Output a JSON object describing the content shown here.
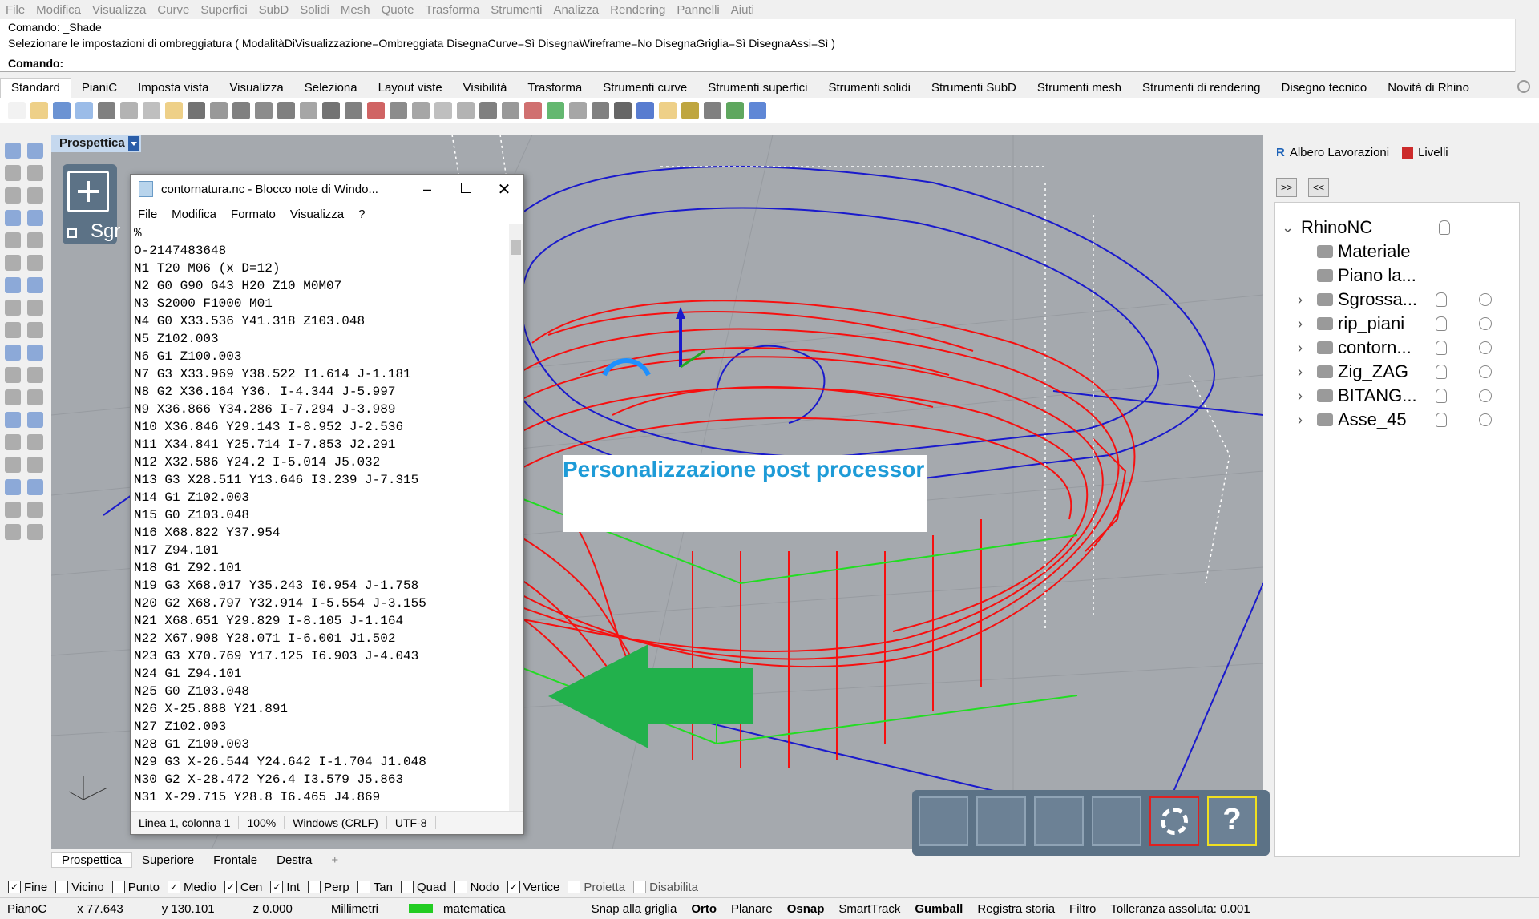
{
  "menubar": [
    "File",
    "Modifica",
    "Visualizza",
    "Curve",
    "Superfici",
    "SubD",
    "Solidi",
    "Mesh",
    "Quote",
    "Trasforma",
    "Strumenti",
    "Analizza",
    "Rendering",
    "Pannelli",
    "Aiuti"
  ],
  "command": {
    "line1": "Comando: _Shade",
    "line2": "Selezionare le impostazioni di ombreggiatura ( ModalitàDiVisualizzazione=Ombreggiata  DisegnaCurve=Sì  DisegnaWireframe=No  DisegnaGriglia=Sì  DisegnaAssi=Sì )",
    "prompt": "Comando:"
  },
  "tabs": [
    "Standard",
    "PianiC",
    "Imposta vista",
    "Visualizza",
    "Seleziona",
    "Layout viste",
    "Visibilità",
    "Trasforma",
    "Strumenti curve",
    "Strumenti superfici",
    "Strumenti solidi",
    "Strumenti SubD",
    "Strumenti mesh",
    "Strumenti di rendering",
    "Disegno tecnico",
    "Novità di Rhino"
  ],
  "viewport": {
    "title": "Prospettica",
    "overlay_text": "Personalizzazione post processor",
    "panel_label": "Sgr"
  },
  "notepad": {
    "title": "contornatura.nc - Blocco note di Windo...",
    "menu": [
      "File",
      "Modifica",
      "Formato",
      "Visualizza",
      "?"
    ],
    "lines": [
      "%",
      "O-2147483648",
      "N1 T20 M06 (x D=12)",
      "N2 G0 G90 G43 H20 Z10 M0M07",
      "N3 S2000 F1000 M01",
      "N4 G0 X33.536 Y41.318 Z103.048",
      "N5 Z102.003",
      "N6 G1 Z100.003",
      "N7 G3 X33.969 Y38.522 I1.614 J-1.181",
      "N8 G2 X36.164 Y36. I-4.344 J-5.997",
      "N9 X36.866 Y34.286 I-7.294 J-3.989",
      "N10 X36.846 Y29.143 I-8.952 J-2.536",
      "N11 X34.841 Y25.714 I-7.853 J2.291",
      "N12 X32.586 Y24.2 I-5.014 J5.032",
      "N13 G3 X28.511 Y13.646 I3.239 J-7.315",
      "N14 G1 Z102.003",
      "N15 G0 Z103.048",
      "N16 X68.822 Y37.954",
      "N17 Z94.101",
      "N18 G1 Z92.101",
      "N19 G3 X68.017 Y35.243 I0.954 J-1.758",
      "N20 G2 X68.797 Y32.914 I-5.554 J-3.155",
      "N21 X68.651 Y29.829 I-8.105 J-1.164",
      "N22 X67.908 Y28.071 I-6.001 J1.502",
      "N23 G3 X70.769 Y17.125 I6.903 J-4.043",
      "N24 G1 Z94.101",
      "N25 G0 Z103.048",
      "N26 X-25.888 Y21.891",
      "N27 Z102.003",
      "N28 G1 Z100.003",
      "N29 G3 X-26.544 Y24.642 I-1.704 J1.048",
      "N30 G2 X-28.472 Y26.4 I3.579 J5.863",
      "N31 X-29.715 Y28.8 I6.465 J4.869"
    ],
    "status": [
      "Linea 1, colonna 1",
      "100%",
      "Windows (CRLF)",
      "UTF-8"
    ]
  },
  "panel": {
    "tab1": "Albero Lavorazioni",
    "tab2": "Livelli",
    "tree": [
      "RhinoNC",
      "Materiale",
      "Piano la...",
      "Sgrossa...",
      "rip_piani",
      "contorn...",
      "Zig_ZAG",
      "BITANG...",
      "Asse_45"
    ]
  },
  "viewport_tabs": [
    "Prospettica",
    "Superiore",
    "Frontale",
    "Destra"
  ],
  "osnaps": [
    {
      "label": "Fine",
      "checked": true
    },
    {
      "label": "Vicino",
      "checked": false
    },
    {
      "label": "Punto",
      "checked": false
    },
    {
      "label": "Medio",
      "checked": true
    },
    {
      "label": "Cen",
      "checked": true
    },
    {
      "label": "Int",
      "checked": true
    },
    {
      "label": "Perp",
      "checked": false
    },
    {
      "label": "Tan",
      "checked": false
    },
    {
      "label": "Quad",
      "checked": false
    },
    {
      "label": "Nodo",
      "checked": false
    },
    {
      "label": "Vertice",
      "checked": true
    },
    {
      "label": "Proietta",
      "checked": false
    },
    {
      "label": "Disabilita",
      "checked": false
    }
  ],
  "status": {
    "plane": "PianoC",
    "x": "x 77.643",
    "y": "y 130.101",
    "z": "z 0.000",
    "units": "Millimetri",
    "layer": "matematica",
    "items": [
      "Snap alla griglia",
      "Orto",
      "Planare",
      "Osnap",
      "SmartTrack",
      "Gumball",
      "Registra storia",
      "Filtro"
    ],
    "tolerance": "Tolleranza assoluta: 0.001"
  },
  "colors": {
    "toolpath": "#ff0000",
    "boundary": "#1a1acc",
    "stock": "#22dd22",
    "arrow": "#22b14c",
    "overlay_text": "#1e9bd7"
  }
}
